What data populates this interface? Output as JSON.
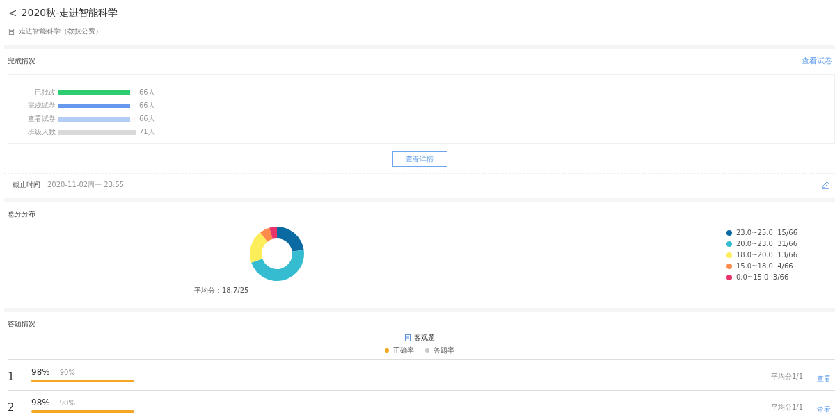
{
  "header": {
    "back": "<",
    "title": "2020秋-走进智能科学",
    "subtitle": "走进智能科学（教技公费）"
  },
  "completion": {
    "title": "完成情况",
    "link": "查看试卷",
    "bars": [
      {
        "label": "已批改",
        "value": "66人",
        "level": 0.93,
        "color": "#2ecc71"
      },
      {
        "label": "完成试卷",
        "value": "66人",
        "level": 0.93,
        "color": "#6699ee"
      },
      {
        "label": "查看试卷",
        "value": "66人",
        "level": 0.93,
        "color": "#b3cdf6"
      },
      {
        "label": "班级人数",
        "value": "71人",
        "level": 1,
        "color": "#d9d9d9"
      }
    ],
    "details_button": "查看详情",
    "deadline_label": "截止时间",
    "deadline": "2020-11-02周一 23:55"
  },
  "distribution": {
    "title": "总分分布",
    "average": "平均分：18.7/25",
    "chart_data": {
      "type": "donut",
      "categories": [
        "23.0~25.0",
        "20.0~23.0",
        "18.0~20.0",
        "15.0~18.0",
        "0.0~15.0"
      ],
      "values": [
        22.7,
        47.0,
        19.7,
        6.1,
        4.5
      ],
      "colors": [
        "#0a6aa1",
        "#35bcd0",
        "#fcee5a",
        "#fd8c4c",
        "#e8336b"
      ],
      "value_labels": [
        "15/66",
        "31/66",
        "13/66",
        "4/66",
        "3/66"
      ]
    }
  },
  "answers": {
    "title": "答题情况",
    "type_label": "客观题",
    "legend": [
      {
        "label": "正确率",
        "color": "#f5a623"
      },
      {
        "label": "答题率",
        "color": "#c8c8c8"
      }
    ],
    "rows": [
      {
        "number": "1",
        "accuracy": "98%",
        "answer_rate": "90%",
        "level": 0.98,
        "average": "平均分1/1",
        "link": "查看"
      },
      {
        "number": "2",
        "accuracy": "98%",
        "answer_rate": "90%",
        "level": 0.98,
        "average": "平均分1/1",
        "link": "查看"
      }
    ]
  }
}
